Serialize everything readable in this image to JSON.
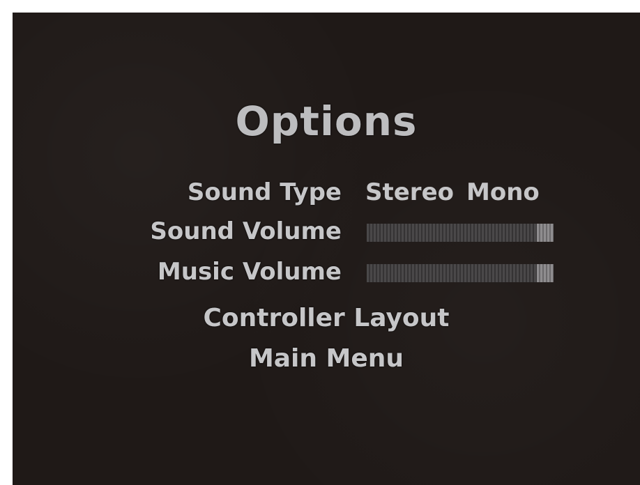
{
  "menu": {
    "title": "Options",
    "sound_type": {
      "label": "Sound Type",
      "options": [
        "Stereo",
        "Mono"
      ]
    },
    "sound_volume": {
      "label": "Sound Volume",
      "level": 1.0
    },
    "music_volume": {
      "label": "Music Volume",
      "level": 1.0
    },
    "controller_layout": "Controller Layout",
    "main_menu": "Main Menu"
  }
}
